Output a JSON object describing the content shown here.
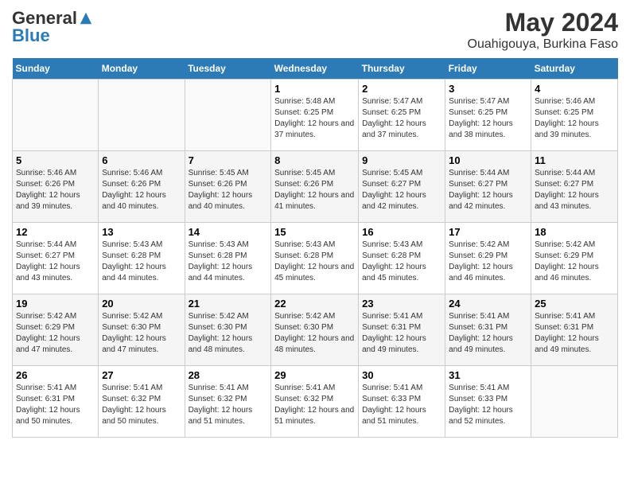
{
  "header": {
    "logo_general": "General",
    "logo_blue": "Blue",
    "month_title": "May 2024",
    "location": "Ouahigouya, Burkina Faso"
  },
  "weekdays": [
    "Sunday",
    "Monday",
    "Tuesday",
    "Wednesday",
    "Thursday",
    "Friday",
    "Saturday"
  ],
  "weeks": [
    [
      {
        "day": "",
        "sunrise": "",
        "sunset": "",
        "daylight": ""
      },
      {
        "day": "",
        "sunrise": "",
        "sunset": "",
        "daylight": ""
      },
      {
        "day": "",
        "sunrise": "",
        "sunset": "",
        "daylight": ""
      },
      {
        "day": "1",
        "sunrise": "Sunrise: 5:48 AM",
        "sunset": "Sunset: 6:25 PM",
        "daylight": "Daylight: 12 hours and 37 minutes."
      },
      {
        "day": "2",
        "sunrise": "Sunrise: 5:47 AM",
        "sunset": "Sunset: 6:25 PM",
        "daylight": "Daylight: 12 hours and 37 minutes."
      },
      {
        "day": "3",
        "sunrise": "Sunrise: 5:47 AM",
        "sunset": "Sunset: 6:25 PM",
        "daylight": "Daylight: 12 hours and 38 minutes."
      },
      {
        "day": "4",
        "sunrise": "Sunrise: 5:46 AM",
        "sunset": "Sunset: 6:25 PM",
        "daylight": "Daylight: 12 hours and 39 minutes."
      }
    ],
    [
      {
        "day": "5",
        "sunrise": "Sunrise: 5:46 AM",
        "sunset": "Sunset: 6:26 PM",
        "daylight": "Daylight: 12 hours and 39 minutes."
      },
      {
        "day": "6",
        "sunrise": "Sunrise: 5:46 AM",
        "sunset": "Sunset: 6:26 PM",
        "daylight": "Daylight: 12 hours and 40 minutes."
      },
      {
        "day": "7",
        "sunrise": "Sunrise: 5:45 AM",
        "sunset": "Sunset: 6:26 PM",
        "daylight": "Daylight: 12 hours and 40 minutes."
      },
      {
        "day": "8",
        "sunrise": "Sunrise: 5:45 AM",
        "sunset": "Sunset: 6:26 PM",
        "daylight": "Daylight: 12 hours and 41 minutes."
      },
      {
        "day": "9",
        "sunrise": "Sunrise: 5:45 AM",
        "sunset": "Sunset: 6:27 PM",
        "daylight": "Daylight: 12 hours and 42 minutes."
      },
      {
        "day": "10",
        "sunrise": "Sunrise: 5:44 AM",
        "sunset": "Sunset: 6:27 PM",
        "daylight": "Daylight: 12 hours and 42 minutes."
      },
      {
        "day": "11",
        "sunrise": "Sunrise: 5:44 AM",
        "sunset": "Sunset: 6:27 PM",
        "daylight": "Daylight: 12 hours and 43 minutes."
      }
    ],
    [
      {
        "day": "12",
        "sunrise": "Sunrise: 5:44 AM",
        "sunset": "Sunset: 6:27 PM",
        "daylight": "Daylight: 12 hours and 43 minutes."
      },
      {
        "day": "13",
        "sunrise": "Sunrise: 5:43 AM",
        "sunset": "Sunset: 6:28 PM",
        "daylight": "Daylight: 12 hours and 44 minutes."
      },
      {
        "day": "14",
        "sunrise": "Sunrise: 5:43 AM",
        "sunset": "Sunset: 6:28 PM",
        "daylight": "Daylight: 12 hours and 44 minutes."
      },
      {
        "day": "15",
        "sunrise": "Sunrise: 5:43 AM",
        "sunset": "Sunset: 6:28 PM",
        "daylight": "Daylight: 12 hours and 45 minutes."
      },
      {
        "day": "16",
        "sunrise": "Sunrise: 5:43 AM",
        "sunset": "Sunset: 6:28 PM",
        "daylight": "Daylight: 12 hours and 45 minutes."
      },
      {
        "day": "17",
        "sunrise": "Sunrise: 5:42 AM",
        "sunset": "Sunset: 6:29 PM",
        "daylight": "Daylight: 12 hours and 46 minutes."
      },
      {
        "day": "18",
        "sunrise": "Sunrise: 5:42 AM",
        "sunset": "Sunset: 6:29 PM",
        "daylight": "Daylight: 12 hours and 46 minutes."
      }
    ],
    [
      {
        "day": "19",
        "sunrise": "Sunrise: 5:42 AM",
        "sunset": "Sunset: 6:29 PM",
        "daylight": "Daylight: 12 hours and 47 minutes."
      },
      {
        "day": "20",
        "sunrise": "Sunrise: 5:42 AM",
        "sunset": "Sunset: 6:30 PM",
        "daylight": "Daylight: 12 hours and 47 minutes."
      },
      {
        "day": "21",
        "sunrise": "Sunrise: 5:42 AM",
        "sunset": "Sunset: 6:30 PM",
        "daylight": "Daylight: 12 hours and 48 minutes."
      },
      {
        "day": "22",
        "sunrise": "Sunrise: 5:42 AM",
        "sunset": "Sunset: 6:30 PM",
        "daylight": "Daylight: 12 hours and 48 minutes."
      },
      {
        "day": "23",
        "sunrise": "Sunrise: 5:41 AM",
        "sunset": "Sunset: 6:31 PM",
        "daylight": "Daylight: 12 hours and 49 minutes."
      },
      {
        "day": "24",
        "sunrise": "Sunrise: 5:41 AM",
        "sunset": "Sunset: 6:31 PM",
        "daylight": "Daylight: 12 hours and 49 minutes."
      },
      {
        "day": "25",
        "sunrise": "Sunrise: 5:41 AM",
        "sunset": "Sunset: 6:31 PM",
        "daylight": "Daylight: 12 hours and 49 minutes."
      }
    ],
    [
      {
        "day": "26",
        "sunrise": "Sunrise: 5:41 AM",
        "sunset": "Sunset: 6:31 PM",
        "daylight": "Daylight: 12 hours and 50 minutes."
      },
      {
        "day": "27",
        "sunrise": "Sunrise: 5:41 AM",
        "sunset": "Sunset: 6:32 PM",
        "daylight": "Daylight: 12 hours and 50 minutes."
      },
      {
        "day": "28",
        "sunrise": "Sunrise: 5:41 AM",
        "sunset": "Sunset: 6:32 PM",
        "daylight": "Daylight: 12 hours and 51 minutes."
      },
      {
        "day": "29",
        "sunrise": "Sunrise: 5:41 AM",
        "sunset": "Sunset: 6:32 PM",
        "daylight": "Daylight: 12 hours and 51 minutes."
      },
      {
        "day": "30",
        "sunrise": "Sunrise: 5:41 AM",
        "sunset": "Sunset: 6:33 PM",
        "daylight": "Daylight: 12 hours and 51 minutes."
      },
      {
        "day": "31",
        "sunrise": "Sunrise: 5:41 AM",
        "sunset": "Sunset: 6:33 PM",
        "daylight": "Daylight: 12 hours and 52 minutes."
      },
      {
        "day": "",
        "sunrise": "",
        "sunset": "",
        "daylight": ""
      }
    ]
  ]
}
